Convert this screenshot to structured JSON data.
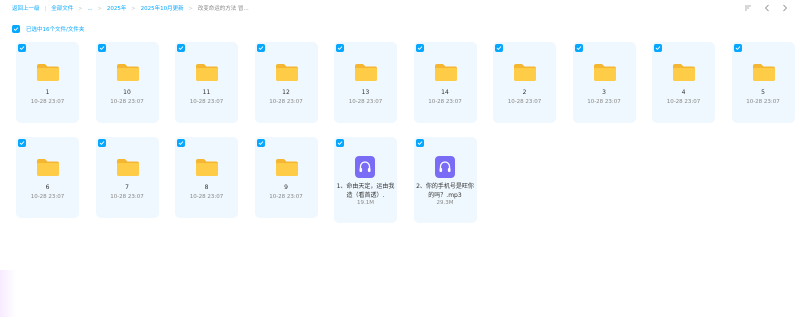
{
  "breadcrumb": {
    "back": "返回上一级",
    "all_files": "全部文件",
    "ellipsis": "...",
    "folder_2025": "2025年",
    "folder_month": "2025年10月更新",
    "current": "改变命运的方法 冒..."
  },
  "toolbar": {
    "sort_icon": "sort-icon",
    "back_icon": "chevron-left-icon",
    "forward_icon": "chevron-right-icon"
  },
  "selection": {
    "label": "已选中16个文件/文件夹"
  },
  "colors": {
    "accent": "#06a7ff",
    "card_bg": "#eff8fe",
    "folder": "#ffc73d",
    "audio": "#7b6cf6"
  },
  "items": [
    {
      "name": "1",
      "time": "10-28 23:07",
      "kind": "folder"
    },
    {
      "name": "10",
      "time": "10-28 23:07",
      "kind": "folder"
    },
    {
      "name": "11",
      "time": "10-28 23:07",
      "kind": "folder"
    },
    {
      "name": "12",
      "time": "10-28 23:07",
      "kind": "folder"
    },
    {
      "name": "13",
      "time": "10-28 23:07",
      "kind": "folder"
    },
    {
      "name": "14",
      "time": "10-28 23:07",
      "kind": "folder"
    },
    {
      "name": "2",
      "time": "10-28 23:07",
      "kind": "folder"
    },
    {
      "name": "3",
      "time": "10-28 23:07",
      "kind": "folder"
    },
    {
      "name": "4",
      "time": "10-28 23:07",
      "kind": "folder"
    },
    {
      "name": "5",
      "time": "10-28 23:07",
      "kind": "folder"
    },
    {
      "name": "6",
      "time": "10-28 23:07",
      "kind": "folder"
    },
    {
      "name": "7",
      "time": "10-28 23:07",
      "kind": "folder"
    },
    {
      "name": "8",
      "time": "10-28 23:07",
      "kind": "folder"
    },
    {
      "name": "9",
      "time": "10-28 23:07",
      "kind": "folder"
    },
    {
      "name": "1、命由天定，运由我造（看首透）.",
      "size": "19.1M",
      "kind": "audio"
    },
    {
      "name": "2、你的手机号是旺你的吗？.mp3",
      "size": "29.3M",
      "kind": "audio"
    }
  ]
}
